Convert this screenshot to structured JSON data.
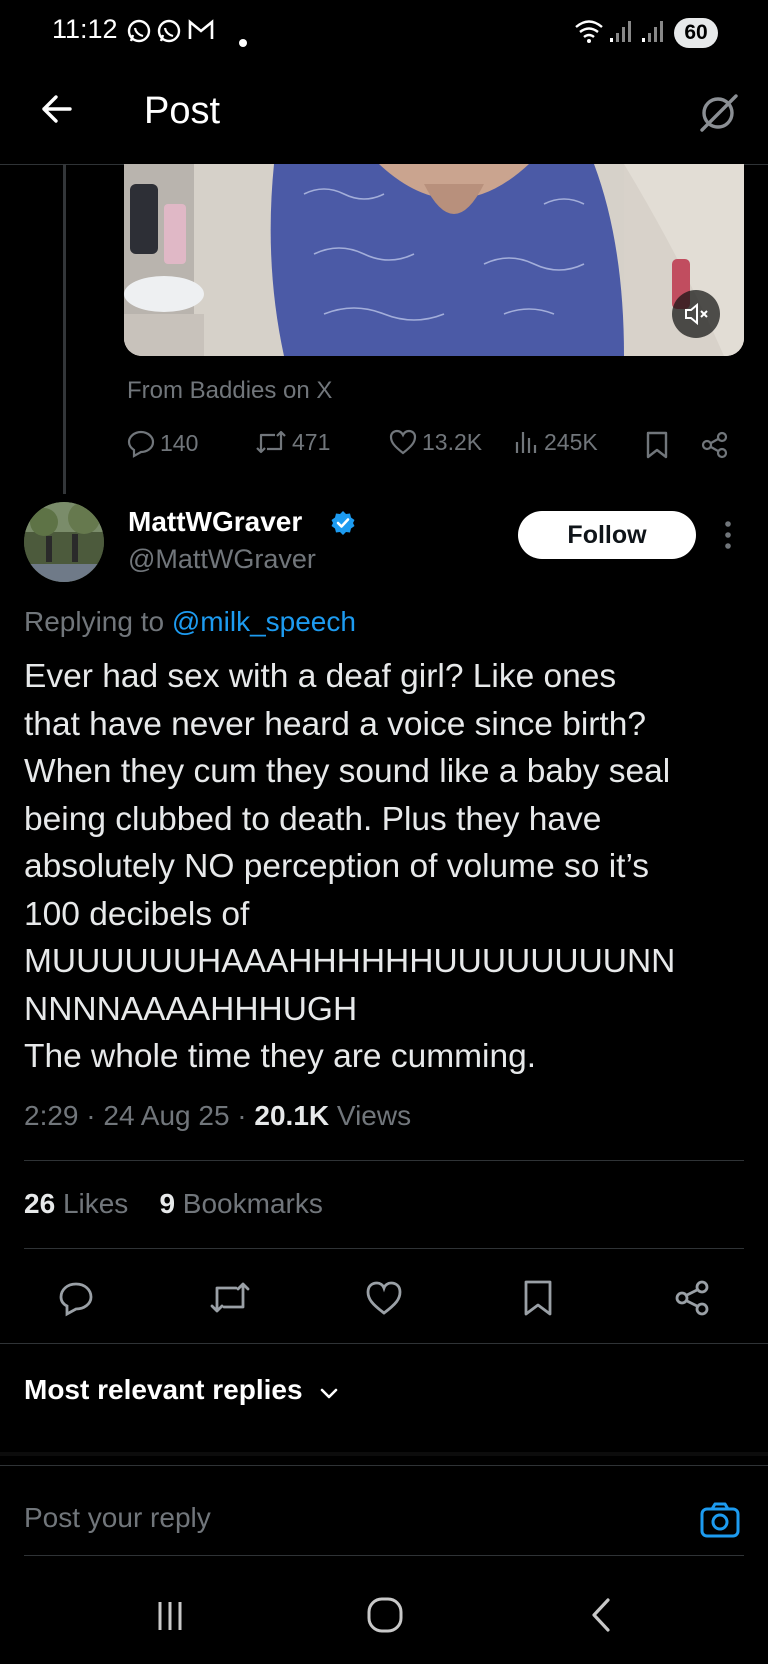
{
  "status_bar": {
    "time": "11:12",
    "battery": "60",
    "notification_icons": [
      "whatsapp-icon",
      "whatsapp-icon",
      "gmail-icon",
      "dot-icon"
    ],
    "system_icons": [
      "wifi-icon",
      "signal-icon",
      "signal-icon"
    ]
  },
  "header": {
    "title": "Post",
    "back_icon": "arrow-left-icon",
    "grok_icon": "grok-icon"
  },
  "parent_post": {
    "source": "From Baddies on X",
    "metrics": {
      "replies": "140",
      "reposts": "471",
      "likes": "13.2K",
      "views": "245K"
    }
  },
  "main_post": {
    "author_name": "MattWGraver",
    "handle": "@MattWGraver",
    "follow_label": "Follow",
    "replying_prefix": "Replying to",
    "replying_to": "@milk_speech",
    "text": "Ever had sex with a deaf girl? Like ones\nthat have never heard a voice since birth?\nWhen they cum they sound like a baby seal\nbeing clubbed to death. Plus they have\nabsolutely NO perception of volume so it’s\n100 decibels of\nMUUUUUUHAAAHHHHHHUUUUUUUUNN\nNNNNAAAAHHHUGH\nThe whole time they are cumming.",
    "time": "2:29",
    "date": "24 Aug 25",
    "views_count": "20.1K",
    "views_label": "Views",
    "likes_count": "26",
    "likes_label": "Likes",
    "bookmarks_count": "9",
    "bookmarks_label": "Bookmarks"
  },
  "replies_section": {
    "sort_label": "Most relevant replies"
  },
  "composer": {
    "placeholder": "Post your reply"
  },
  "colors": {
    "background": "#000000",
    "text": "#e7e9ea",
    "secondary": "#71767b",
    "accent": "#1d9bf0",
    "divider": "#2f3336"
  }
}
